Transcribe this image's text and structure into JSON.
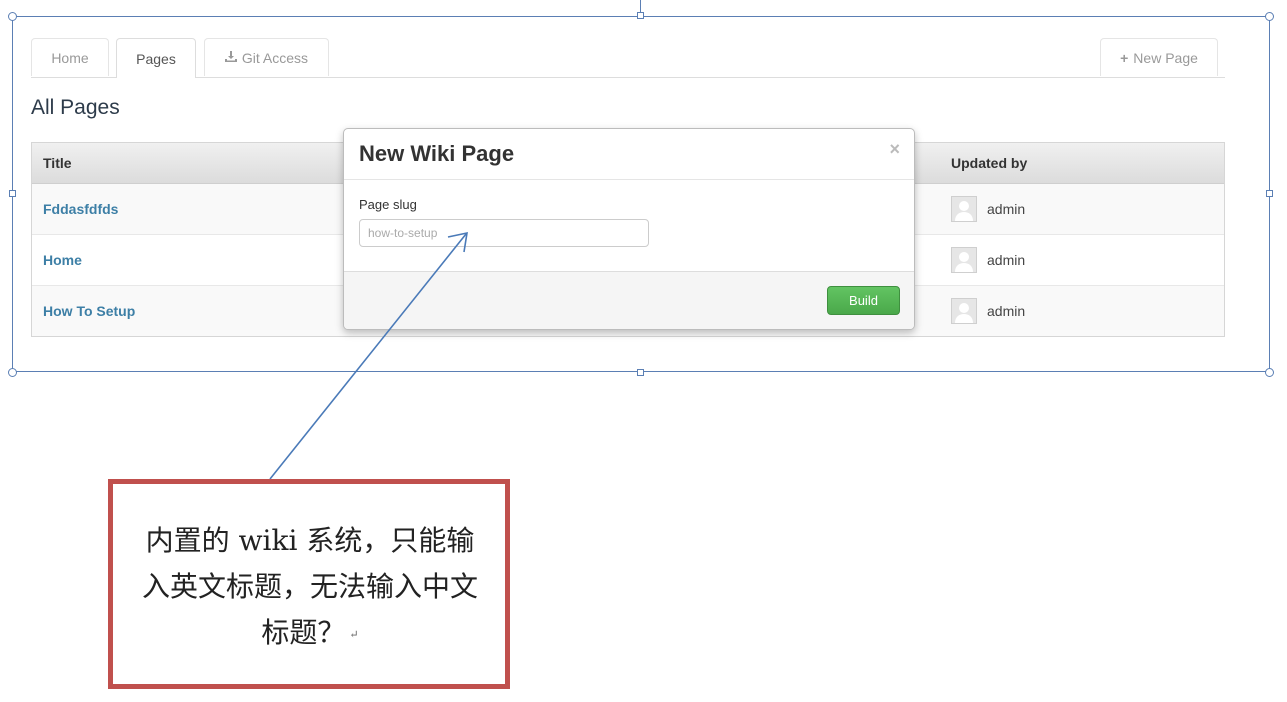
{
  "tabs": [
    {
      "label": "Home"
    },
    {
      "label": "Pages"
    },
    {
      "label": "Git Access",
      "icon": "download-icon"
    }
  ],
  "new_page_button": {
    "label": "New Page",
    "icon": "plus-icon"
  },
  "page_title": "All Pages",
  "table": {
    "columns": {
      "title": "Title",
      "updated_by": "Updated by"
    },
    "rows": [
      {
        "title": "Fddasfdfds",
        "updated_by": "admin"
      },
      {
        "title": "Home",
        "updated_by": "admin"
      },
      {
        "title": "How To Setup",
        "updated_by": "admin"
      }
    ]
  },
  "modal": {
    "title": "New Wiki Page",
    "close": "×",
    "field_label": "Page slug",
    "input_placeholder": "how-to-setup",
    "input_value": "",
    "submit_label": "Build"
  },
  "annotation": {
    "text": "内置的 wiki 系统，只能输入英文标题，无法输入中文标题？",
    "paragraph_mark": "↵"
  },
  "colors": {
    "link": "#3d7fa6",
    "build_button": "#5bb75b",
    "annotation_border": "#c0504d",
    "selection_frame": "#5b7fb4",
    "arrow": "#4a7ab8"
  }
}
